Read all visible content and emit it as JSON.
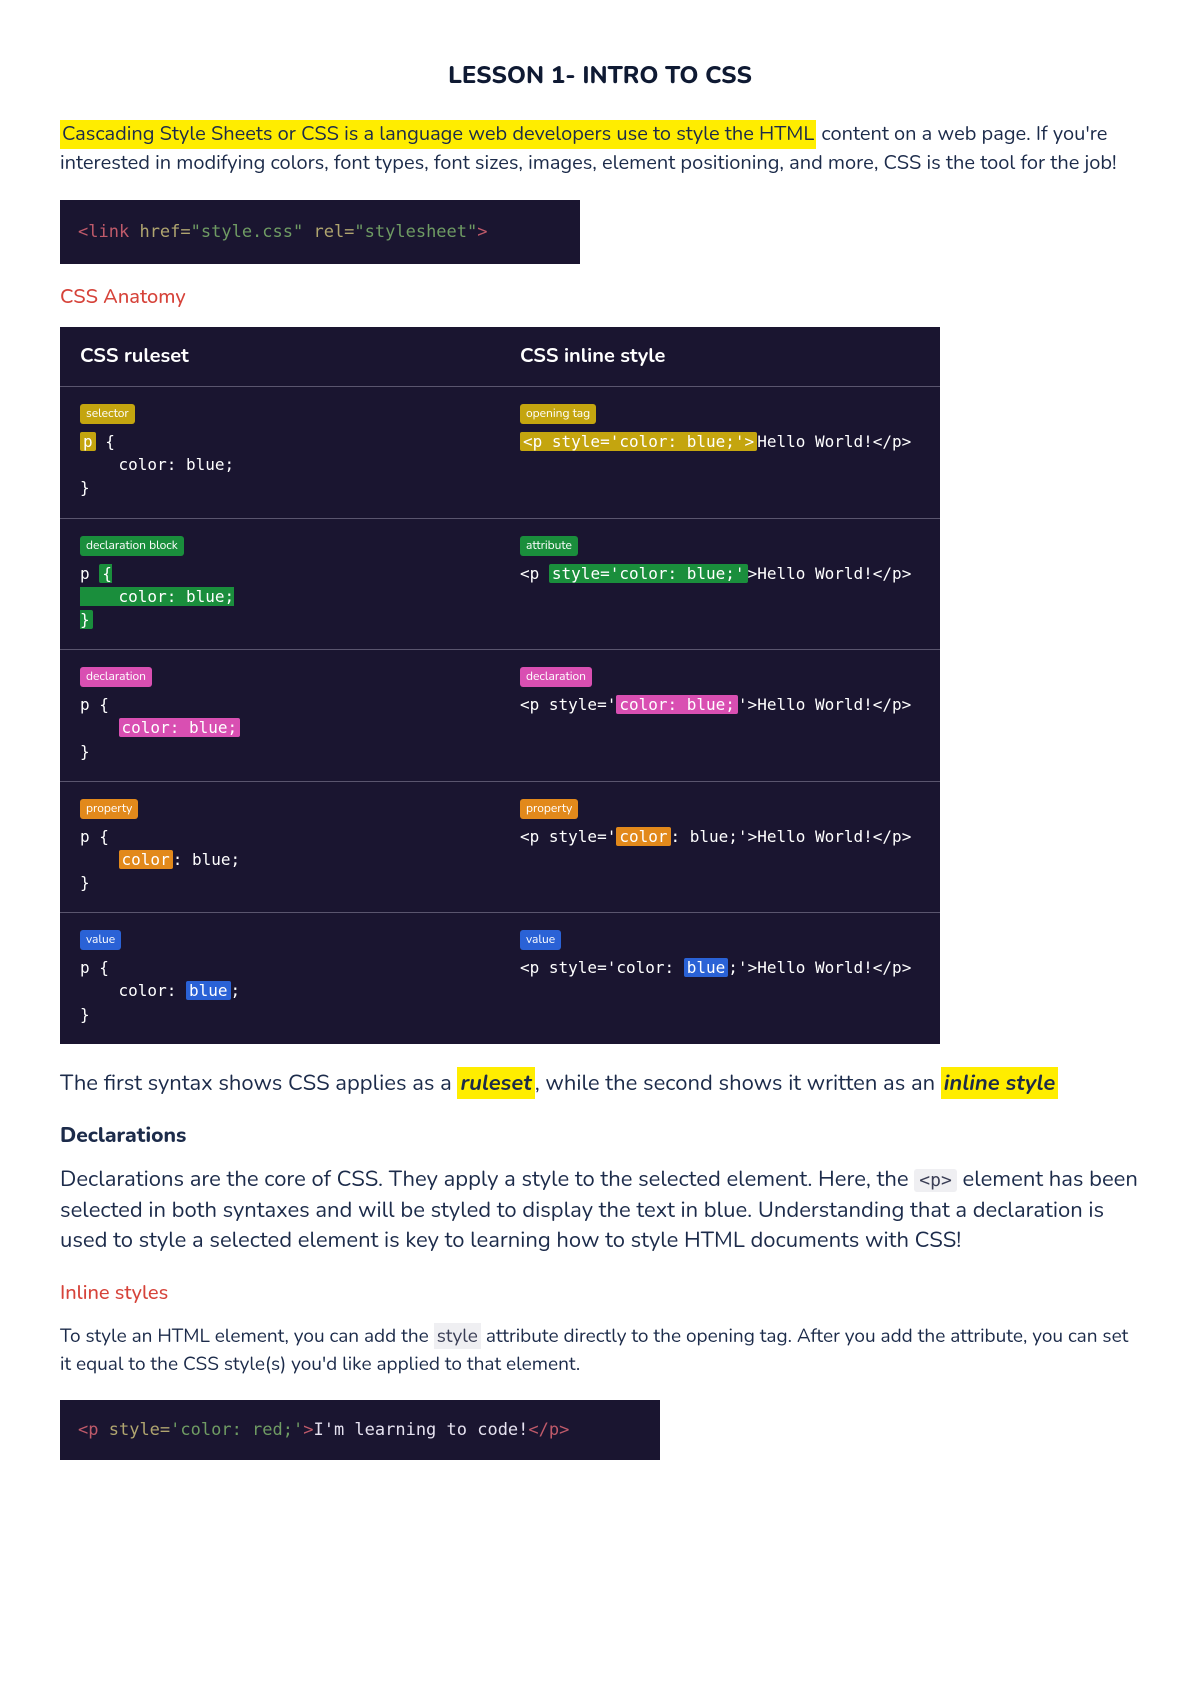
{
  "title": "LESSON 1- INTRO TO CSS",
  "intro": {
    "highlighted": "Cascading Style Sheets or CSS is a language web developers use to style the HTML",
    "rest": " content on a web page. If you're interested in modifying colors, font types, font sizes, images, element positioning, and more, CSS is the tool for the job!"
  },
  "code1": {
    "open": "<",
    "tag": "link",
    "sp": " ",
    "attr_href": "href=",
    "val_href": "\"style.css\"",
    "attr_rel": " rel=",
    "val_rel": "\"stylesheet\"",
    "close": ">"
  },
  "anatomy_heading": "CSS Anatomy",
  "anatomy": {
    "head_left": "CSS ruleset",
    "head_right": "CSS inline style",
    "rows": [
      {
        "left_badge": "selector",
        "left_color": "yellow",
        "right_badge": "opening tag",
        "right_color": "yellow",
        "left_hl": "p",
        "left_pre": "",
        "left_post": " {\n    color: blue;\n}",
        "right_pre": "",
        "right_hl": "<p style='color: blue;'>",
        "right_post": "Hello World!</p>"
      },
      {
        "left_badge": "declaration block",
        "left_color": "green",
        "right_badge": "attribute",
        "right_color": "green",
        "left_hl": "{\n    color: blue;\n}",
        "left_pre": "p ",
        "left_post": "",
        "right_pre": "<p ",
        "right_hl": "style='color: blue;'",
        "right_post": ">Hello World!</p>"
      },
      {
        "left_badge": "declaration",
        "left_color": "pink",
        "right_badge": "declaration",
        "right_color": "pink",
        "left_hl": "color: blue;",
        "left_pre": "p {\n    ",
        "left_post": "\n}",
        "right_pre": "<p style='",
        "right_hl": "color: blue;",
        "right_post": "'>Hello World!</p>"
      },
      {
        "left_badge": "property",
        "left_color": "orange",
        "right_badge": "property",
        "right_color": "orange",
        "left_hl": "color",
        "left_pre": "p {\n    ",
        "left_post": ": blue;\n}",
        "right_pre": "<p style='",
        "right_hl": "color",
        "right_post": ": blue;'>Hello World!</p>"
      },
      {
        "left_badge": "value",
        "left_color": "blue",
        "right_badge": "value",
        "right_color": "blue",
        "left_hl": "blue",
        "left_pre": "p {\n    color: ",
        "left_post": ";\n}",
        "right_pre": "<p style='color: ",
        "right_hl": "blue",
        "right_post": ";'>Hello World!</p>"
      }
    ]
  },
  "syntax_para": {
    "p1": "The first syntax shows CSS applies as a ",
    "h1": "ruleset",
    "p2": ", while the second shows it written as an ",
    "h2": "inline style"
  },
  "decl_heading": "Declarations",
  "decl_para": {
    "p1": "Declarations are the core of CSS. They apply a style to the selected element. Here, the ",
    "code": "<p>",
    "p2": " element has been selected in both syntaxes and will be styled to display the text in blue. Understanding that a declaration is used to style a selected element is key to learning how to style HTML documents with CSS!"
  },
  "inline_heading": "Inline styles",
  "inline_para": {
    "p1": "To style an HTML element, you can add the ",
    "style_word": "style",
    "p2": " attribute directly to the opening tag. After you add the attribute, you can set it equal to the CSS style(s) you'd like applied to that element."
  },
  "code2": {
    "a": "<",
    "b": "p ",
    "c": "style=",
    "d": "'color: red;'",
    "e": ">",
    "f": "I'm learning to code!",
    "g": "</",
    "h": "p",
    "i": ">"
  }
}
